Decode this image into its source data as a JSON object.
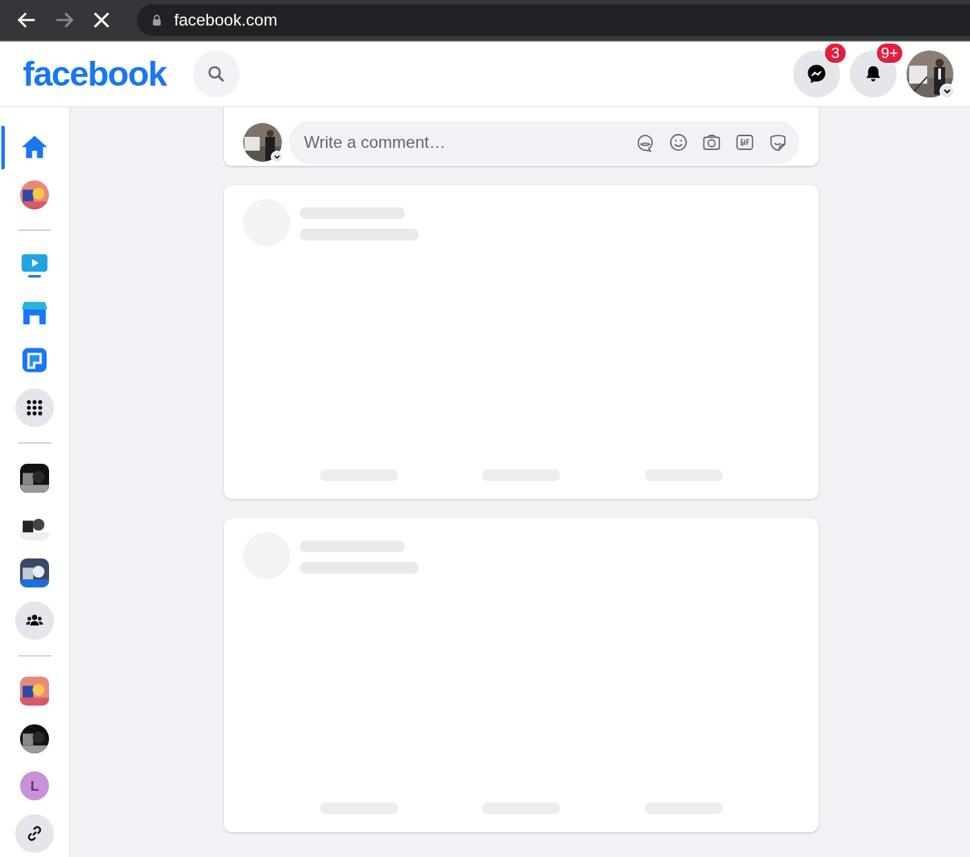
{
  "browser": {
    "url": "facebook.com",
    "loading": true
  },
  "header": {
    "logo": "facebook",
    "actions": [
      {
        "kind": "messenger",
        "badge": "3"
      },
      {
        "kind": "notifications",
        "badge": "9+"
      }
    ],
    "account": {
      "kind": "picture"
    }
  },
  "sidebar": {
    "items": [
      {
        "kind": "home",
        "selected": true
      },
      {
        "kind": "picture",
        "selected": false
      },
      {
        "kind": "divider"
      },
      {
        "kind": "watch",
        "selected": false
      },
      {
        "kind": "marketplace",
        "selected": false
      },
      {
        "kind": "gaming",
        "selected": false
      },
      {
        "kind": "menu",
        "selected": false
      },
      {
        "kind": "divider"
      },
      {
        "kind": "picture",
        "selected": false
      },
      {
        "kind": "picture",
        "selected": false
      },
      {
        "kind": "picture",
        "selected": false
      },
      {
        "kind": "groups",
        "selected": false
      },
      {
        "kind": "divider"
      },
      {
        "kind": "picture",
        "selected": false
      },
      {
        "kind": "picture",
        "selected": false
      },
      {
        "kind": "letter",
        "letter": "L",
        "color": "#c991d9",
        "selected": false
      },
      {
        "kind": "link",
        "selected": false
      }
    ]
  },
  "comment_card": {
    "composer": {
      "placeholder": "Write a comment…"
    }
  },
  "feed": [
    {
      "kind": "loading"
    },
    {
      "kind": "loading"
    }
  ]
}
